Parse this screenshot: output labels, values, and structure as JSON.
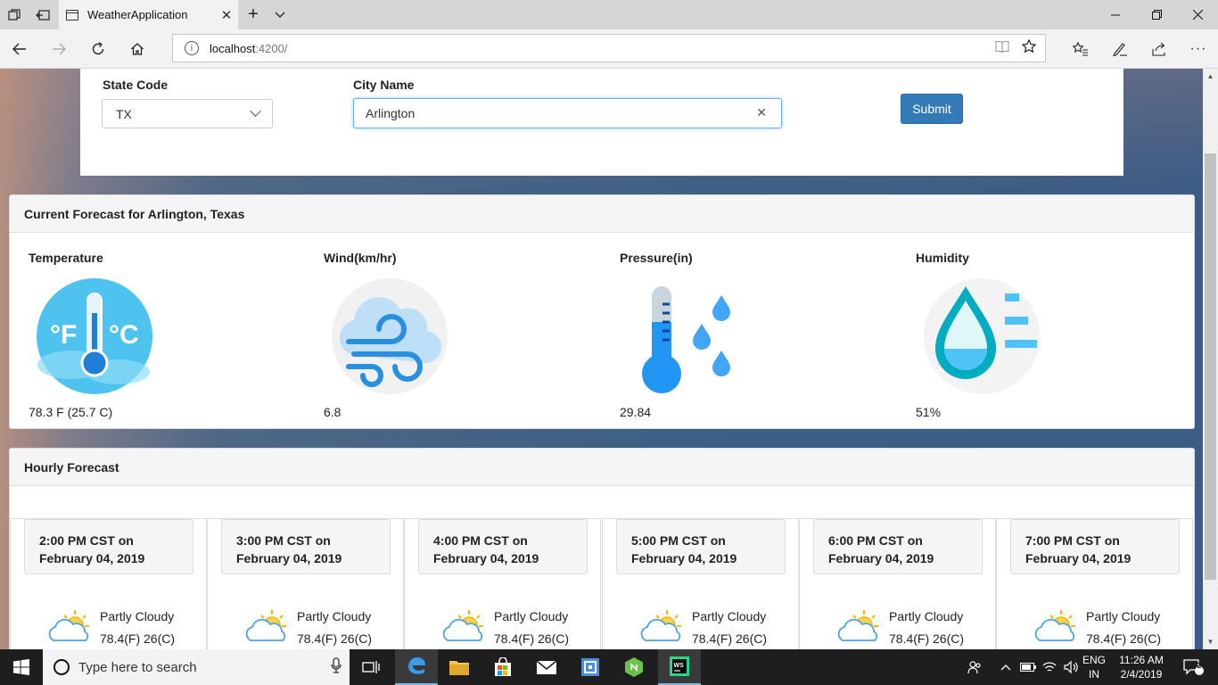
{
  "browser": {
    "tab_title": "WeatherApplication",
    "address_host": "localhost",
    "address_port": ":4200/"
  },
  "search": {
    "state_label": "State Code",
    "state_value": "TX",
    "city_label": "City Name",
    "city_value": "Arlington",
    "submit_label": "Submit"
  },
  "current": {
    "heading": "Current Forecast for Arlington, Texas",
    "metrics": [
      {
        "label": "Temperature",
        "value": "78.3 F (25.7 C)",
        "icon": "thermometer-icon"
      },
      {
        "label": "Wind(km/hr)",
        "value": "6.8",
        "icon": "wind-icon"
      },
      {
        "label": "Pressure(in)",
        "value": "29.84",
        "icon": "pressure-icon"
      },
      {
        "label": "Humidity",
        "value": "51%",
        "icon": "humidity-icon"
      }
    ]
  },
  "hourly": {
    "heading": "Hourly Forecast",
    "items": [
      {
        "time": "2:00 PM CST on",
        "date": "February 04, 2019",
        "condition": "Partly Cloudy",
        "temp": "78.4(F) 26(C)"
      },
      {
        "time": "3:00 PM CST on",
        "date": "February 04, 2019",
        "condition": "Partly Cloudy",
        "temp": "78.4(F) 26(C)"
      },
      {
        "time": "4:00 PM CST on",
        "date": "February 04, 2019",
        "condition": "Partly Cloudy",
        "temp": "78.4(F) 26(C)"
      },
      {
        "time": "5:00 PM CST on",
        "date": "February 04, 2019",
        "condition": "Partly Cloudy",
        "temp": "78.4(F) 26(C)"
      },
      {
        "time": "6:00 PM CST on",
        "date": "February 04, 2019",
        "condition": "Partly Cloudy",
        "temp": "78.4(F) 26(C)"
      },
      {
        "time": "7:00 PM CST on",
        "date": "February 04, 2019",
        "condition": "Partly Cloudy",
        "temp": "78.4(F) 26(C)"
      }
    ]
  },
  "taskbar": {
    "search_placeholder": "Type here to search",
    "lang_top": "ENG",
    "lang_bottom": "IN",
    "time": "11:26 AM",
    "date": "2/4/2019",
    "notification_count": "2"
  }
}
